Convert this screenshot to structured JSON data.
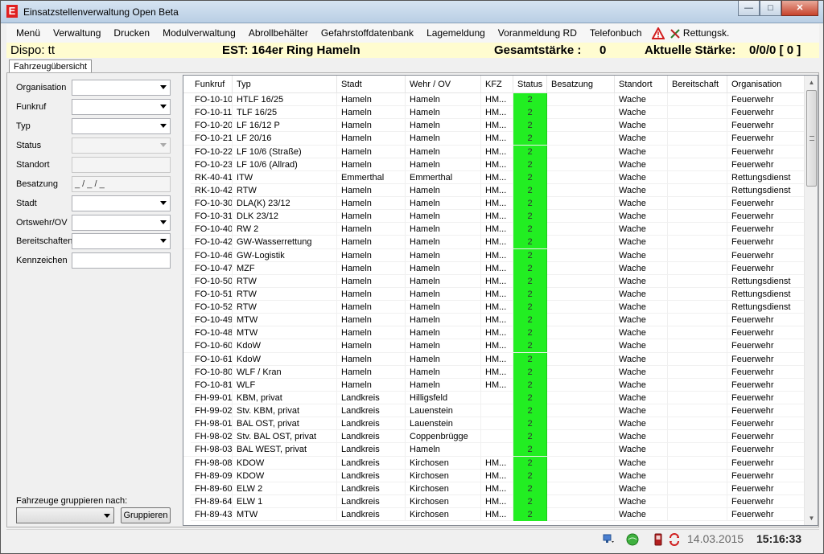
{
  "window": {
    "title": "Einsatzstellenverwaltung Open Beta",
    "app_icon_letter": "E"
  },
  "menu": {
    "items": [
      "Menü",
      "Verwaltung",
      "Drucken",
      "Modulverwaltung",
      "Abrollbehälter",
      "Gefahrstoffdatenbank",
      "Lagemeldung",
      "Voranmeldung RD",
      "Telefonbuch"
    ],
    "rettung_label": "Rettungsk."
  },
  "infobar": {
    "dispo": "Dispo: tt",
    "est": "EST: 164er Ring Hameln",
    "gesamt_label": "Gesamtstärke :",
    "gesamt_value": "0",
    "aktuell_label": "Aktuelle Stärke:",
    "aktuell_value": "0/0/0 [ 0 ]"
  },
  "tab": {
    "label": "Fahrzeugübersicht"
  },
  "filters": {
    "organisation": "Organisation",
    "funkruf": "Funkruf",
    "typ": "Typ",
    "status": "Status",
    "standort": "Standort",
    "besatzung": "Besatzung",
    "besatzung_value": "_ / _ / _",
    "stadt": "Stadt",
    "ortswehr": "Ortswehr/OV",
    "bereitschaften": "Bereitschaften",
    "kennzeichen": "Kennzeichen",
    "group_label": "Fahrzeuge gruppieren nach:",
    "group_button": "Gruppieren"
  },
  "grid": {
    "columns": [
      "Funkruf",
      "Typ",
      "Stadt",
      "Wehr / OV",
      "KFZ",
      "Status",
      "Besatzung",
      "Standort",
      "Bereitschaft",
      "Organisation"
    ],
    "rows": [
      [
        "FO-10-10",
        "HTLF 16/25",
        "Hameln",
        "Hameln",
        "HM...",
        "2",
        "",
        "Wache",
        "",
        "Feuerwehr"
      ],
      [
        "FO-10-11",
        "TLF 16/25",
        "Hameln",
        "Hameln",
        "HM...",
        "2",
        "",
        "Wache",
        "",
        "Feuerwehr"
      ],
      [
        "FO-10-20",
        "LF 16/12 P",
        "Hameln",
        "Hameln",
        "HM...",
        "2",
        "",
        "Wache",
        "",
        "Feuerwehr"
      ],
      [
        "FO-10-21",
        "LF 20/16",
        "Hameln",
        "Hameln",
        "HM...",
        "2",
        "",
        "Wache",
        "",
        "Feuerwehr"
      ],
      [
        "FO-10-22",
        "LF 10/6 (Straße)",
        "Hameln",
        "Hameln",
        "HM...",
        "2",
        "",
        "Wache",
        "",
        "Feuerwehr"
      ],
      [
        "FO-10-23",
        "LF 10/6 (Allrad)",
        "Hameln",
        "Hameln",
        "HM...",
        "2",
        "",
        "Wache",
        "",
        "Feuerwehr"
      ],
      [
        "RK-40-41",
        "ITW",
        "Emmerthal",
        "Emmerthal",
        "HM...",
        "2",
        "",
        "Wache",
        "",
        "Rettungsdienst"
      ],
      [
        "RK-10-42",
        "RTW",
        "Hameln",
        "Hameln",
        "HM...",
        "2",
        "",
        "Wache",
        "",
        "Rettungsdienst"
      ],
      [
        "FO-10-30",
        "DLA(K) 23/12",
        "Hameln",
        "Hameln",
        "HM...",
        "2",
        "",
        "Wache",
        "",
        "Feuerwehr"
      ],
      [
        "FO-10-31",
        "DLK 23/12",
        "Hameln",
        "Hameln",
        "HM...",
        "2",
        "",
        "Wache",
        "",
        "Feuerwehr"
      ],
      [
        "FO-10-40",
        "RW 2",
        "Hameln",
        "Hameln",
        "HM...",
        "2",
        "",
        "Wache",
        "",
        "Feuerwehr"
      ],
      [
        "FO-10-42",
        "GW-Wasserrettung",
        "Hameln",
        "Hameln",
        "HM...",
        "2",
        "",
        "Wache",
        "",
        "Feuerwehr"
      ],
      [
        "FO-10-46",
        "GW-Logistik",
        "Hameln",
        "Hameln",
        "HM...",
        "2",
        "",
        "Wache",
        "",
        "Feuerwehr"
      ],
      [
        "FO-10-47",
        "MZF",
        "Hameln",
        "Hameln",
        "HM...",
        "2",
        "",
        "Wache",
        "",
        "Feuerwehr"
      ],
      [
        "FO-10-50",
        "RTW",
        "Hameln",
        "Hameln",
        "HM...",
        "2",
        "",
        "Wache",
        "",
        "Rettungsdienst"
      ],
      [
        "FO-10-51",
        "RTW",
        "Hameln",
        "Hameln",
        "HM...",
        "2",
        "",
        "Wache",
        "",
        "Rettungsdienst"
      ],
      [
        "FO-10-52",
        "RTW",
        "Hameln",
        "Hameln",
        "HM...",
        "2",
        "",
        "Wache",
        "",
        "Rettungsdienst"
      ],
      [
        "FO-10-49",
        "MTW",
        "Hameln",
        "Hameln",
        "HM...",
        "2",
        "",
        "Wache",
        "",
        "Feuerwehr"
      ],
      [
        "FO-10-48",
        "MTW",
        "Hameln",
        "Hameln",
        "HM...",
        "2",
        "",
        "Wache",
        "",
        "Feuerwehr"
      ],
      [
        "FO-10-60",
        "KdoW",
        "Hameln",
        "Hameln",
        "HM...",
        "2",
        "",
        "Wache",
        "",
        "Feuerwehr"
      ],
      [
        "FO-10-61",
        "KdoW",
        "Hameln",
        "Hameln",
        "HM...",
        "2",
        "",
        "Wache",
        "",
        "Feuerwehr"
      ],
      [
        "FO-10-80",
        "WLF / Kran",
        "Hameln",
        "Hameln",
        "HM...",
        "2",
        "",
        "Wache",
        "",
        "Feuerwehr"
      ],
      [
        "FO-10-81",
        "WLF",
        "Hameln",
        "Hameln",
        "HM...",
        "2",
        "",
        "Wache",
        "",
        "Feuerwehr"
      ],
      [
        "FH-99-01",
        "KBM, privat",
        "Landkreis",
        "Hilligsfeld",
        "",
        "2",
        "",
        "Wache",
        "",
        "Feuerwehr"
      ],
      [
        "FH-99-02",
        "Stv. KBM, privat",
        "Landkreis",
        "Lauenstein",
        "",
        "2",
        "",
        "Wache",
        "",
        "Feuerwehr"
      ],
      [
        "FH-98-01",
        "BAL OST, privat",
        "Landkreis",
        "Lauenstein",
        "",
        "2",
        "",
        "Wache",
        "",
        "Feuerwehr"
      ],
      [
        "FH-98-02",
        "Stv. BAL OST, privat",
        "Landkreis",
        "Coppenbrügge",
        "",
        "2",
        "",
        "Wache",
        "",
        "Feuerwehr"
      ],
      [
        "FH-98-03",
        "BAL WEST, privat",
        "Landkreis",
        "Hameln",
        "",
        "2",
        "",
        "Wache",
        "",
        "Feuerwehr"
      ],
      [
        "FH-98-08",
        "KDOW",
        "Landkreis",
        "Kirchosen",
        "HM...",
        "2",
        "",
        "Wache",
        "",
        "Feuerwehr"
      ],
      [
        "FH-89-09",
        "KDOW",
        "Landkreis",
        "Kirchosen",
        "HM...",
        "2",
        "",
        "Wache",
        "",
        "Feuerwehr"
      ],
      [
        "FH-89-60",
        "ELW 2",
        "Landkreis",
        "Kirchosen",
        "HM...",
        "2",
        "",
        "Wache",
        "",
        "Feuerwehr"
      ],
      [
        "FH-89-64",
        "ELW 1",
        "Landkreis",
        "Kirchosen",
        "HM...",
        "2",
        "",
        "Wache",
        "",
        "Feuerwehr"
      ],
      [
        "FH-89-43",
        "MTW",
        "Landkreis",
        "Kirchosen",
        "HM...",
        "2",
        "",
        "Wache",
        "",
        "Feuerwehr"
      ]
    ],
    "status_color": "#22ee22"
  },
  "statusbar": {
    "date": "14.03.2015",
    "time": "15:16:33"
  },
  "icons": [
    "app-icon",
    "minimize-icon",
    "maximize-icon",
    "close-icon",
    "warning-triangle-icon",
    "rettungsk-icon",
    "network-icon",
    "globe-icon",
    "phone-icon",
    "sync-icon"
  ]
}
